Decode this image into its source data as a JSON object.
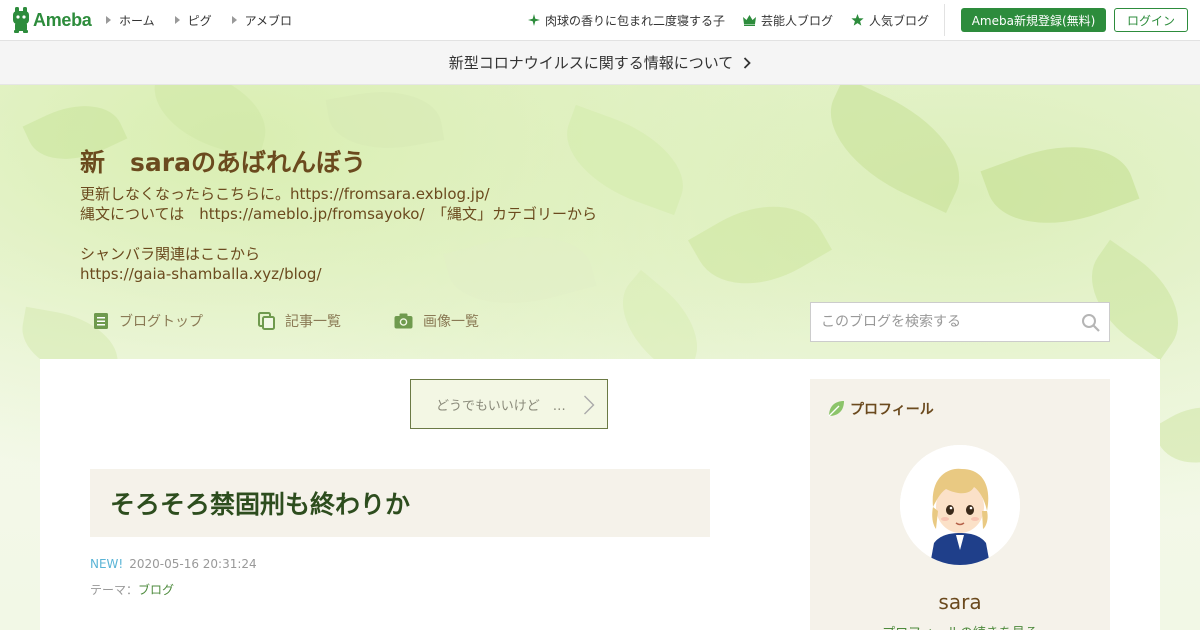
{
  "topbar": {
    "logo_text": "Ameba",
    "nav_left": [
      {
        "label": "ホーム"
      },
      {
        "label": "ピグ"
      },
      {
        "label": "アメブロ"
      }
    ],
    "nav_right": [
      {
        "label": "肉球の香りに包まれ二度寝する子",
        "icon": "sparkle-icon"
      },
      {
        "label": "芸能人ブログ",
        "icon": "crown-icon"
      },
      {
        "label": "人気ブログ",
        "icon": "star-icon"
      }
    ],
    "register_label": "Ameba新規登録(無料)",
    "login_label": "ログイン"
  },
  "notice": {
    "text": "新型コロナウイルスに関する情報について"
  },
  "blog": {
    "title": "新　saraのあばれんぼう",
    "description": "更新しなくなったらこちらに。https://fromsara.exblog.jp/\n縄文については　https://ameblo.jp/fromsayoko/　「縄文」カテゴリーから\n\nシャンバラ関連はここから\nhttps://gaia-shamballa.xyz/blog/",
    "nav": [
      {
        "label": "ブログトップ",
        "icon": "document-icon"
      },
      {
        "label": "記事一覧",
        "icon": "copy-icon"
      },
      {
        "label": "画像一覧",
        "icon": "camera-icon"
      }
    ],
    "search_placeholder": "このブログを検索する"
  },
  "entry": {
    "theme_link": "どうでもいいけど　…",
    "title": "そろそろ禁固刑も終わりか",
    "new_badge": "NEW!",
    "date": "2020-05-16 20:31:24",
    "theme_label": "テーマ：",
    "theme_value": "ブログ"
  },
  "profile": {
    "heading": "プロフィール",
    "name": "sara",
    "more": "プロフィールの続きを見る"
  },
  "colors": {
    "brand_green": "#2d8c3c",
    "title_brown": "#6b4a1e",
    "entry_title": "#2d4d1e"
  }
}
